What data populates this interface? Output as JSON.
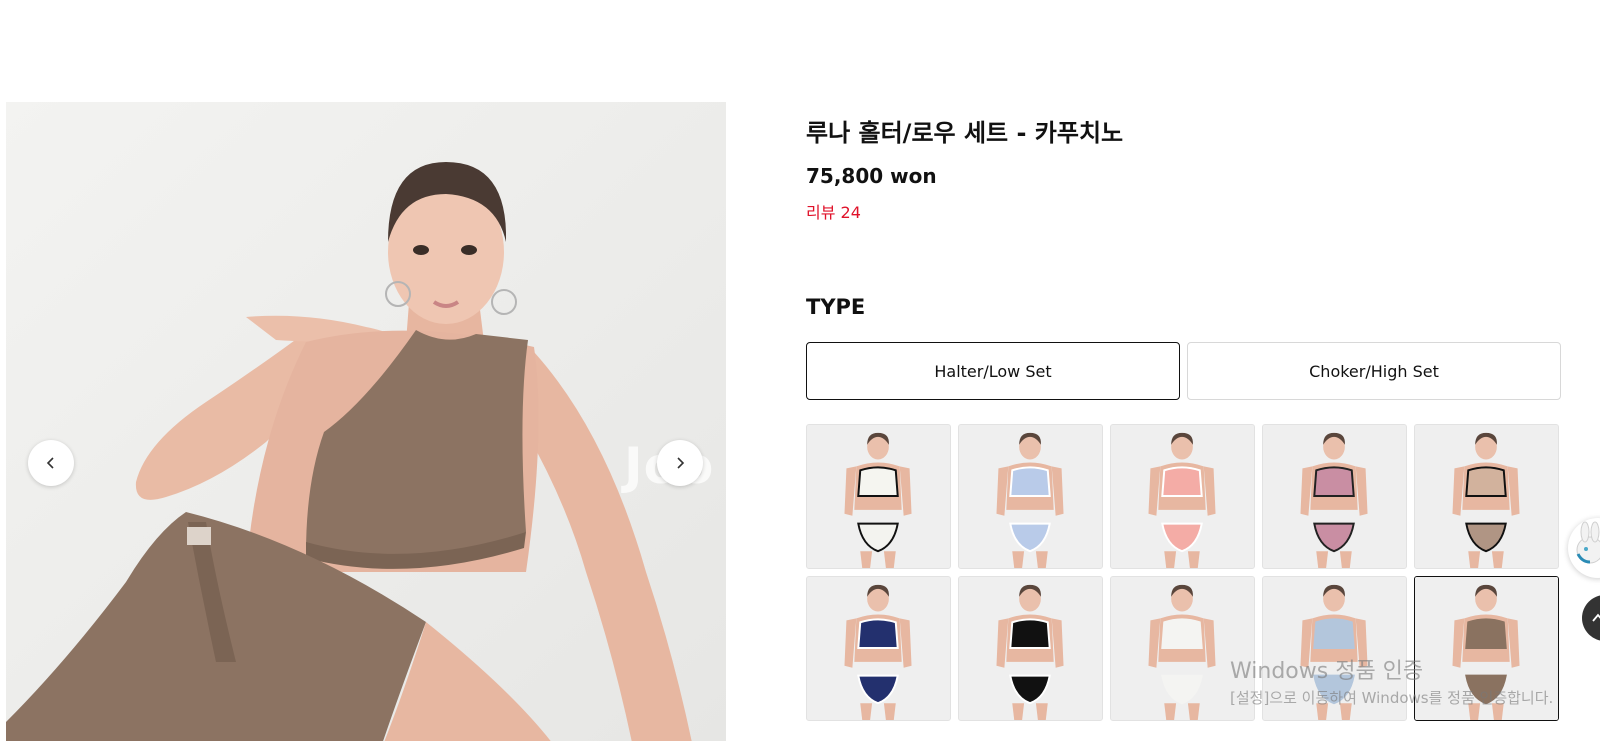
{
  "gallery": {
    "watermark": "Joo",
    "prev_icon": "chevron-left-icon",
    "next_icon": "chevron-right-icon"
  },
  "product": {
    "title": "루나 홀터/로우 세트 - 카푸치노",
    "price": "75,800 won",
    "reviews": "리뷰 24",
    "type_heading": "TYPE",
    "types": [
      "Halter/Low Set",
      "Choker/High Set"
    ],
    "selected_type": "Halter/Low Set"
  },
  "colors": {
    "review_red": "#e0122a",
    "swatches": [
      {
        "top": "#f5f5f0",
        "trim": "#111111",
        "bottom": "#f3f3ef"
      },
      {
        "top": "#b9cbe9",
        "trim": "#ffffff",
        "bottom": "#b9cbe9"
      },
      {
        "top": "#f4aca6",
        "trim": "#ffffff",
        "bottom": "#f4aca6"
      },
      {
        "top": "#c98ea3",
        "trim": "#222222",
        "bottom": "#c98ea3"
      },
      {
        "top": "#d2b29d",
        "trim": "#111111",
        "bottom": "#b09584"
      },
      {
        "top": "#23306e",
        "trim": "#ffffff",
        "bottom": "#23306e"
      },
      {
        "top": "#111111",
        "trim": "#ffffff",
        "bottom": "#111111"
      },
      {
        "top": "#f4f4f2",
        "trim": "#f4f4f2",
        "bottom": "#f4f4f2"
      },
      {
        "top": "#b3c6dc",
        "trim": "#b3c6dc",
        "bottom": "#b3c6dc"
      },
      {
        "top": "#8a7260",
        "trim": "#8a7260",
        "bottom": "#8a7260"
      }
    ],
    "selected_swatch_index": 9
  },
  "system": {
    "activation_line1": "Windows 정품 인증",
    "activation_line2": "[설정]으로 이동하여 Windows를 정품 인증합니다."
  }
}
